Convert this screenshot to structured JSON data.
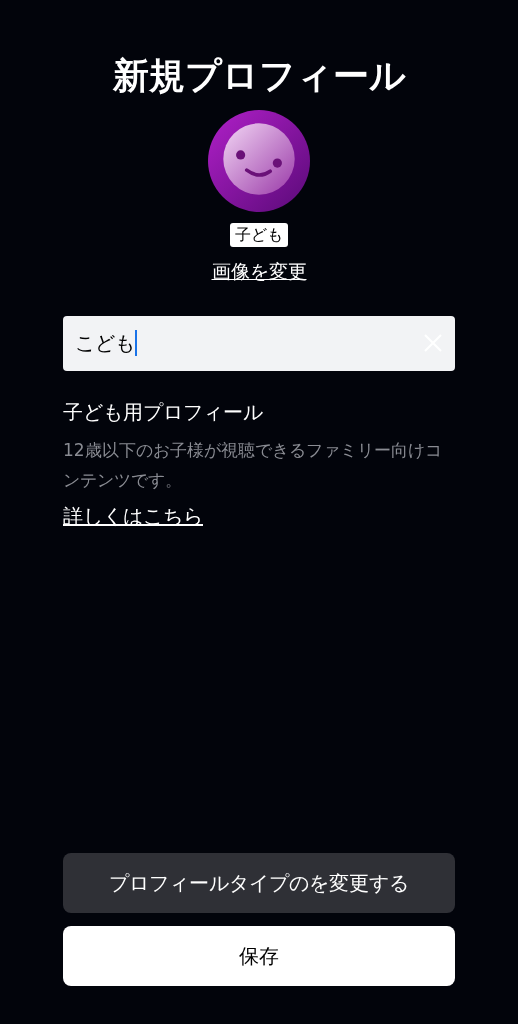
{
  "title": "新規プロフィール",
  "avatar": {
    "badge": "子ども",
    "change_link": "画像を変更"
  },
  "name_field": {
    "value": "こども",
    "focused": true
  },
  "profile_type": {
    "heading": "子ども用プロフィール",
    "description": "12歳以下のお子様が視聴できるファミリー向けコンテンツです。",
    "link": "詳しくはこちら"
  },
  "buttons": [
    {
      "label": "プロフィールタイプのを変更する",
      "kind": "secondary"
    },
    {
      "label": "保存",
      "kind": "primary"
    }
  ]
}
